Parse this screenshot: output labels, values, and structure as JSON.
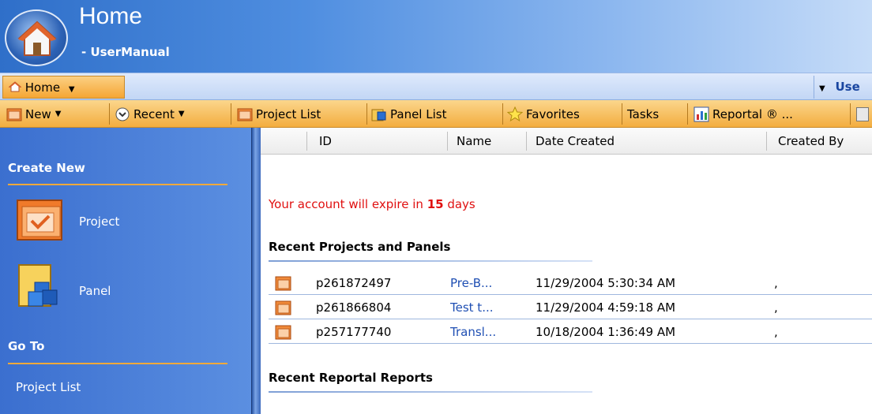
{
  "window": {
    "title": "Home",
    "subtitle": "- UserManual"
  },
  "tabbar": {
    "home_tab": "Home",
    "user_label": "Use"
  },
  "toolbar": {
    "new": "New",
    "recent": "Recent",
    "project_list": "Project List",
    "panel_list": "Panel List",
    "favorites": "Favorites",
    "tasks": "Tasks",
    "reportal": "Reportal ® ..."
  },
  "sidebar": {
    "create_new_heading": "Create New",
    "create_items": [
      "Project",
      "Panel"
    ],
    "go_to_heading": "Go To",
    "go_to_items": [
      "Project List"
    ]
  },
  "grid": {
    "columns": [
      "ID",
      "Name",
      "Date Created",
      "Created By"
    ]
  },
  "notice": {
    "prefix": "Your account will expire in",
    "days": "15",
    "suffix": "days"
  },
  "recent_projects": {
    "title": "Recent Projects and Panels",
    "rows": [
      {
        "id": "p261872497",
        "name": "Pre-B...",
        "date": "11/29/2004 5:30:34 AM",
        "created_by": ","
      },
      {
        "id": "p261866804",
        "name": "Test t...",
        "date": "11/29/2004 4:59:18 AM",
        "created_by": ","
      },
      {
        "id": "p257177740",
        "name": "Transl...",
        "date": "10/18/2004 1:36:49 AM",
        "created_by": ","
      }
    ]
  },
  "recent_reports": {
    "title": "Recent Reportal Reports"
  },
  "icons": {
    "home": "home-icon",
    "new": "project-folder-icon",
    "recent": "recent-chevron-icon",
    "project_list": "project-folder-icon",
    "panel_list": "panel-icon",
    "favorites": "star-icon",
    "reportal": "reportal-chart-icon"
  },
  "colors": {
    "toolbar_orange": "#f3ad3f",
    "sidebar_blue": "#3b6fcf",
    "warning_red": "#e01010",
    "link_blue": "#1f4fb3"
  }
}
